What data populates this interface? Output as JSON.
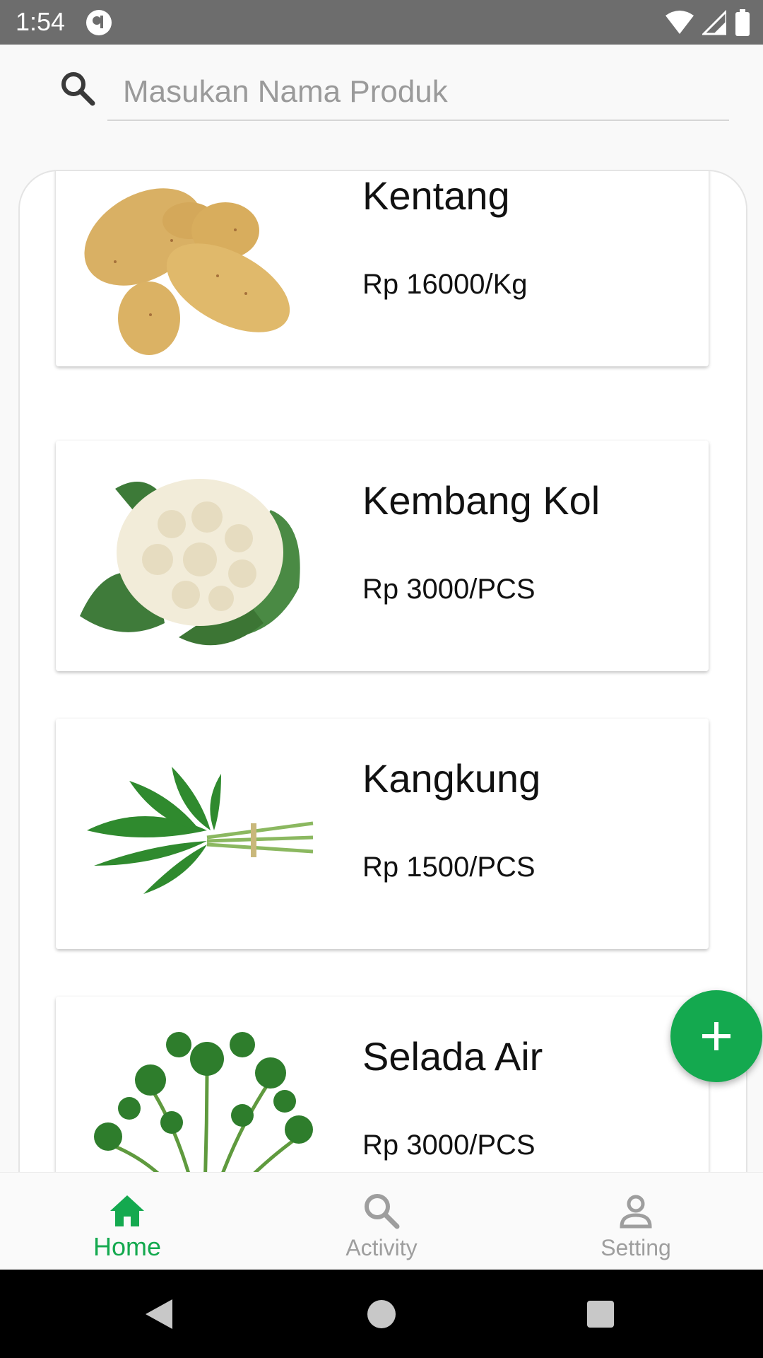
{
  "status_bar": {
    "time": "1:54"
  },
  "search": {
    "placeholder": "Masukan Nama Produk"
  },
  "products": [
    {
      "name": "Kentang",
      "price": "Rp 16000/Kg",
      "image": "potatoes"
    },
    {
      "name": "Kembang Kol",
      "price": "Rp 3000/PCS",
      "image": "cauliflower"
    },
    {
      "name": "Kangkung",
      "price": "Rp 1500/PCS",
      "image": "water-spinach"
    },
    {
      "name": "Selada Air",
      "price": "Rp 3000/PCS",
      "image": "watercress"
    }
  ],
  "fab": {
    "icon": "plus-icon"
  },
  "bottom_nav": {
    "items": [
      {
        "label": "Home",
        "icon": "home-icon",
        "active": true
      },
      {
        "label": "Activity",
        "icon": "search-icon",
        "active": false
      },
      {
        "label": "Setting",
        "icon": "person-icon",
        "active": false
      }
    ]
  },
  "colors": {
    "accent": "#14a94f",
    "status_bar": "#6d6d6d",
    "inactive": "#9e9e9e"
  }
}
